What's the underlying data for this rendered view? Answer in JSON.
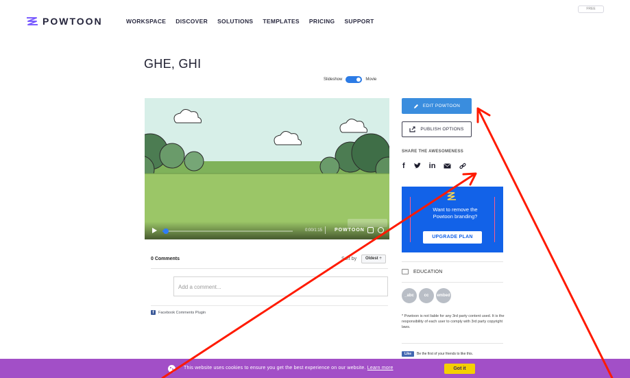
{
  "brand": {
    "name": "POWTOON"
  },
  "header": {
    "nav": [
      "WORKSPACE",
      "DISCOVER",
      "SOLUTIONS",
      "TEMPLATES",
      "PRICING",
      "SUPPORT"
    ],
    "plan_badge": "FREE"
  },
  "page": {
    "title": "GHE, GHI",
    "view_toggle": {
      "left": "Slideshow",
      "right": "Movie",
      "selected": "Movie"
    }
  },
  "video": {
    "time": "0:00/1:15",
    "brand": "POWTOON",
    "progress_fraction": 0.02
  },
  "comments": {
    "count_label": "0 Comments",
    "sort_label": "Sort by",
    "sort_value": "Oldest ÷",
    "placeholder": "Add a comment...",
    "plugin_label": "Facebook Comments Plugin"
  },
  "sidebar": {
    "edit_label": "EDIT POWTOON",
    "publish_label": "PUBLISH OPTIONS",
    "share_label": "SHARE THE AWESOMENESS",
    "social": [
      "f",
      "y",
      "in",
      "mail",
      "link"
    ],
    "promo": {
      "text": "Want to remove the Powtoon branding?",
      "button": "UPGRADE PLAN"
    },
    "folder_label": "EDUCATION",
    "tags": [
      "_abc",
      "cc",
      "embed"
    ],
    "disclaimer": "* Powtoon is not liable for any 3rd party content used. It is the responsibility of each user to comply with 3rd party copyright laws.",
    "like_button": "Like",
    "like_text": "Be the first of your friends to like this."
  },
  "cookie": {
    "text": "This website uses cookies to ensure you get the best experience on our website.",
    "link": "Learn more",
    "button": "Got it"
  },
  "colors": {
    "accent_blue": "#3a8dde",
    "promo_blue": "#1262e8",
    "cookie_purple": "#a24fc7",
    "got_it_yellow": "#f4d000",
    "annotation_red": "#ff1a00"
  }
}
